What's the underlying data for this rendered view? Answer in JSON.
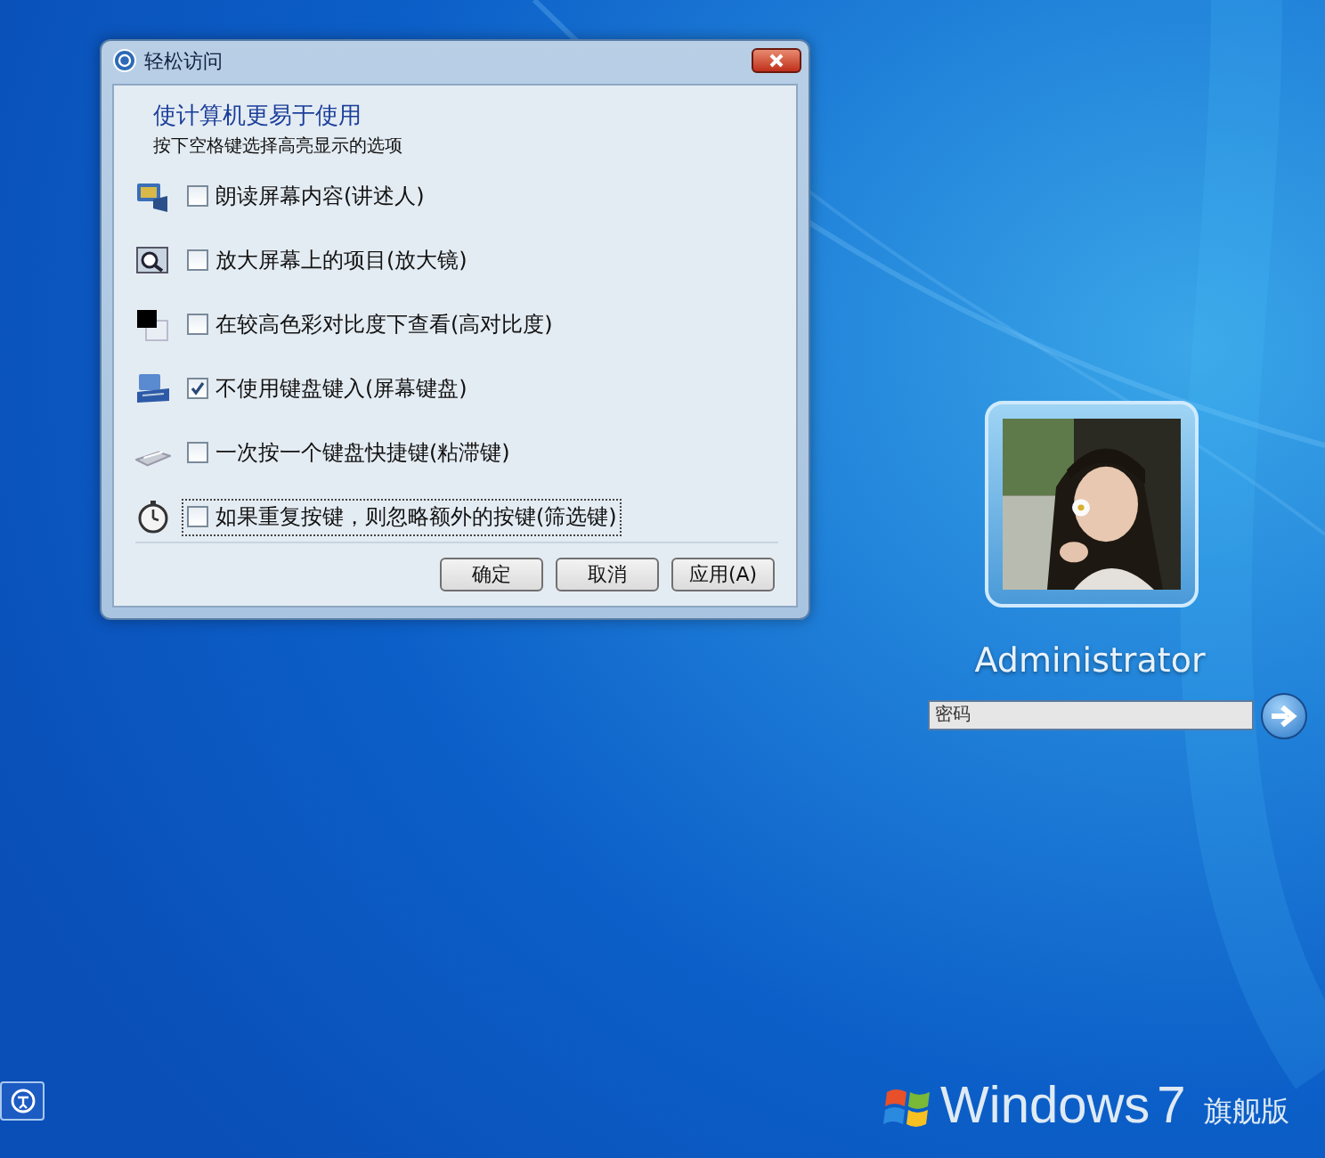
{
  "dialog": {
    "title": "轻松访问",
    "heading": "使计算机更易于使用",
    "instruction": "按下空格键选择高亮显示的选项",
    "options": [
      {
        "kind": "narrator",
        "label": "朗读屏幕内容(讲述人)",
        "checked": false,
        "focused": false
      },
      {
        "kind": "magnifier",
        "label": "放大屏幕上的项目(放大镜)",
        "checked": false,
        "focused": false
      },
      {
        "kind": "contrast",
        "label": "在较高色彩对比度下查看(高对比度)",
        "checked": false,
        "focused": false
      },
      {
        "kind": "keyboard",
        "label": "不使用键盘键入(屏幕键盘)",
        "checked": true,
        "focused": false
      },
      {
        "kind": "sticky",
        "label": "一次按一个键盘快捷键(粘滞键)",
        "checked": false,
        "focused": false
      },
      {
        "kind": "filter",
        "label": "如果重复按键，则忽略额外的按键(筛选键)",
        "checked": false,
        "focused": true
      }
    ],
    "buttons": [
      "确定",
      "取消",
      "应用(A)"
    ]
  },
  "login": {
    "user": "Administrator",
    "password": {
      "placeholder": "密码"
    }
  },
  "branding": {
    "product": "Windows",
    "version": "7",
    "edition": "旗舰版"
  }
}
